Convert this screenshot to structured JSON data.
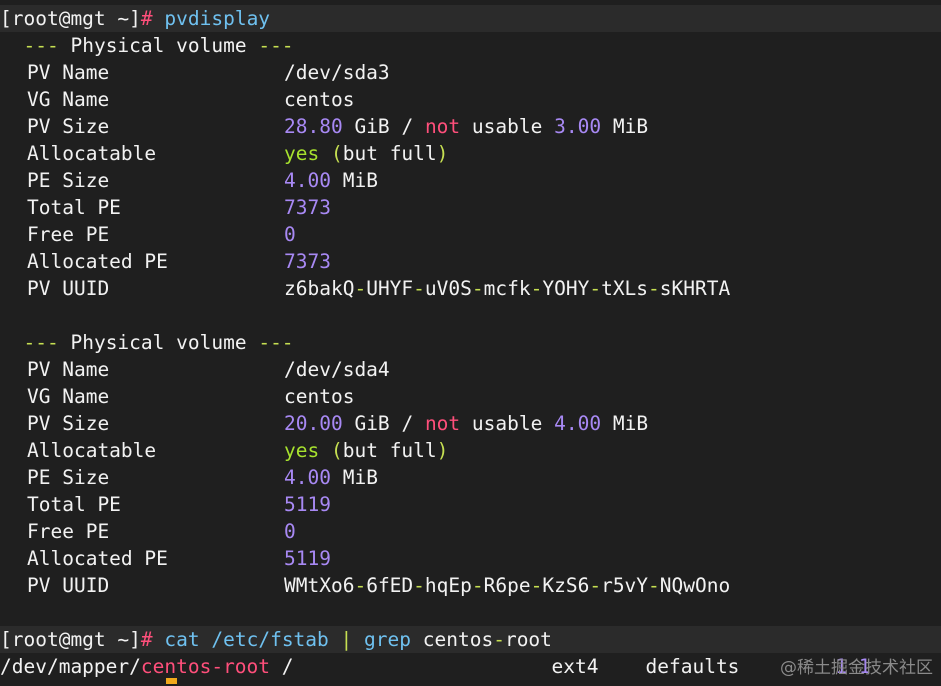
{
  "colors": {
    "background": "#1f1f1f",
    "text": "#f2f2f2",
    "dashes_and_punct": "#c6df52",
    "numbers": "#a889f4",
    "green": "#a7e22e",
    "red": "#ff4f7b",
    "command": "#6fc1f0",
    "cursor": "#f0a91c"
  },
  "prompt1": {
    "user_host": "[root@mgt ~]",
    "hash": "#",
    "command": "pvdisplay"
  },
  "pv1": {
    "header": {
      "dashes_left": "---",
      "title": "Physical volume",
      "dashes_right": "---"
    },
    "pv_name": {
      "key": "PV Name",
      "value": "/dev/sda3"
    },
    "vg_name": {
      "key": "VG Name",
      "value": "centos"
    },
    "pv_size": {
      "key": "PV Size",
      "num": "28.80",
      "unit": "GiB",
      "slash": "/",
      "not": "not",
      "usable": "usable",
      "num2": "3.00",
      "unit2": "MiB"
    },
    "allocatable": {
      "key": "Allocatable",
      "yes": "yes",
      "lp": "(",
      "but_full": "but full",
      "rp": ")"
    },
    "pe_size": {
      "key": "PE Size",
      "num": "4.00",
      "unit": "MiB"
    },
    "total_pe": {
      "key": "Total PE",
      "value": "7373"
    },
    "free_pe": {
      "key": "Free PE",
      "value": "0"
    },
    "allocated_pe": {
      "key": "Allocated PE",
      "value": "7373"
    },
    "pv_uuid": {
      "key": "PV UUID",
      "parts": [
        "z6bakQ",
        "UHYF",
        "uV0S",
        "mcfk",
        "YOHY",
        "tXLs",
        "sKHRTA"
      ],
      "sep": "-"
    }
  },
  "pv2": {
    "header": {
      "dashes_left": "---",
      "title": "Physical volume",
      "dashes_right": "---"
    },
    "pv_name": {
      "key": "PV Name",
      "value": "/dev/sda4"
    },
    "vg_name": {
      "key": "VG Name",
      "value": "centos"
    },
    "pv_size": {
      "key": "PV Size",
      "num": "20.00",
      "unit": "GiB",
      "slash": "/",
      "not": "not",
      "usable": "usable",
      "num2": "4.00",
      "unit2": "MiB"
    },
    "allocatable": {
      "key": "Allocatable",
      "yes": "yes",
      "lp": "(",
      "but_full": "but full",
      "rp": ")"
    },
    "pe_size": {
      "key": "PE Size",
      "num": "4.00",
      "unit": "MiB"
    },
    "total_pe": {
      "key": "Total PE",
      "value": "5119"
    },
    "free_pe": {
      "key": "Free PE",
      "value": "0"
    },
    "allocated_pe": {
      "key": "Allocated PE",
      "value": "5119"
    },
    "pv_uuid": {
      "key": "PV UUID",
      "parts": [
        "WMtXo6",
        "6fED",
        "hqEp",
        "R6pe",
        "KzS6",
        "r5vY",
        "NQwOno"
      ],
      "sep": "-"
    }
  },
  "prompt2": {
    "user_host": "[root@mgt ~]",
    "hash": "#",
    "cmd_cat": "cat",
    "path": "/etc/fstab",
    "pipe": "|",
    "cmd_grep": "grep",
    "arg_a": "centos",
    "arg_dash": "-",
    "arg_b": "root"
  },
  "fstab_line": {
    "device_prefix": "/dev/mapper/",
    "device_name": "centos-root",
    "mount": "/",
    "fstype": "ext4",
    "options": "defaults",
    "dump": "1",
    "pass": "1"
  },
  "watermark": "@稀土掘金技术社区"
}
